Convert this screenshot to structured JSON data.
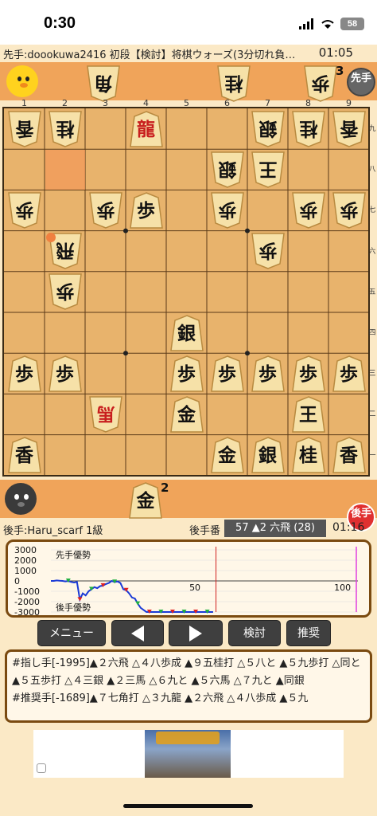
{
  "status_bar": {
    "time": "0:30",
    "battery": "58"
  },
  "header": {
    "title": "先手:doookuwa2416 初段【検討】将棋ウォーズ(3分切れ負…",
    "clock": "01:05"
  },
  "sente_badge": "先手",
  "gote_badge": "後手",
  "top_hand": [
    {
      "label": "角",
      "count": ""
    },
    {
      "label": "桂",
      "count": ""
    },
    {
      "label": "歩",
      "count": "3"
    }
  ],
  "bottom_hand": [
    {
      "label": "金",
      "count": "2"
    }
  ],
  "board": {
    "files": [
      "1",
      "2",
      "3",
      "4",
      "5",
      "6",
      "7",
      "8",
      "9"
    ],
    "ranks": [
      "九",
      "八",
      "七",
      "六",
      "五",
      "四",
      "三",
      "二",
      "一"
    ],
    "pieces": [
      {
        "col": 0,
        "row": 0,
        "label": "香",
        "side": "gote",
        "promoted": false
      },
      {
        "col": 1,
        "row": 0,
        "label": "桂",
        "side": "gote",
        "promoted": false
      },
      {
        "col": 3,
        "row": 0,
        "label": "龍",
        "side": "sente",
        "promoted": true
      },
      {
        "col": 6,
        "row": 0,
        "label": "銀",
        "side": "gote",
        "promoted": false
      },
      {
        "col": 7,
        "row": 0,
        "label": "桂",
        "side": "gote",
        "promoted": false
      },
      {
        "col": 8,
        "row": 0,
        "label": "香",
        "side": "gote",
        "promoted": false
      },
      {
        "col": 5,
        "row": 1,
        "label": "銀",
        "side": "gote",
        "promoted": false
      },
      {
        "col": 6,
        "row": 1,
        "label": "王",
        "side": "gote",
        "promoted": false
      },
      {
        "col": 0,
        "row": 2,
        "label": "歩",
        "side": "gote",
        "promoted": false
      },
      {
        "col": 2,
        "row": 2,
        "label": "歩",
        "side": "gote",
        "promoted": false
      },
      {
        "col": 3,
        "row": 2,
        "label": "歩",
        "side": "sente",
        "promoted": false
      },
      {
        "col": 5,
        "row": 2,
        "label": "歩",
        "side": "gote",
        "promoted": false
      },
      {
        "col": 7,
        "row": 2,
        "label": "歩",
        "side": "gote",
        "promoted": false
      },
      {
        "col": 8,
        "row": 2,
        "label": "歩",
        "side": "gote",
        "promoted": false
      },
      {
        "col": 1,
        "row": 3,
        "label": "飛",
        "side": "gote",
        "promoted": false
      },
      {
        "col": 6,
        "row": 3,
        "label": "歩",
        "side": "gote",
        "promoted": false
      },
      {
        "col": 1,
        "row": 4,
        "label": "歩",
        "side": "gote",
        "promoted": false
      },
      {
        "col": 4,
        "row": 5,
        "label": "銀",
        "side": "sente",
        "promoted": false
      },
      {
        "col": 0,
        "row": 6,
        "label": "歩",
        "side": "sente",
        "promoted": false
      },
      {
        "col": 1,
        "row": 6,
        "label": "歩",
        "side": "sente",
        "promoted": false
      },
      {
        "col": 4,
        "row": 6,
        "label": "歩",
        "side": "sente",
        "promoted": false
      },
      {
        "col": 5,
        "row": 6,
        "label": "歩",
        "side": "sente",
        "promoted": false
      },
      {
        "col": 6,
        "row": 6,
        "label": "歩",
        "side": "sente",
        "promoted": false
      },
      {
        "col": 7,
        "row": 6,
        "label": "歩",
        "side": "sente",
        "promoted": false
      },
      {
        "col": 8,
        "row": 6,
        "label": "歩",
        "side": "sente",
        "promoted": false
      },
      {
        "col": 2,
        "row": 7,
        "label": "馬",
        "side": "gote",
        "promoted": true
      },
      {
        "col": 4,
        "row": 7,
        "label": "金",
        "side": "sente",
        "promoted": false
      },
      {
        "col": 7,
        "row": 7,
        "label": "王",
        "side": "sente",
        "promoted": false
      },
      {
        "col": 0,
        "row": 8,
        "label": "香",
        "side": "sente",
        "promoted": false
      },
      {
        "col": 5,
        "row": 8,
        "label": "金",
        "side": "sente",
        "promoted": false
      },
      {
        "col": 6,
        "row": 8,
        "label": "銀",
        "side": "sente",
        "promoted": false
      },
      {
        "col": 7,
        "row": 8,
        "label": "桂",
        "side": "sente",
        "promoted": false
      },
      {
        "col": 8,
        "row": 8,
        "label": "香",
        "side": "sente",
        "promoted": false
      }
    ],
    "highlight": {
      "col": 1,
      "row": 1
    }
  },
  "info": {
    "gote_player": "後手:Haru_scarf 1級",
    "turn": "後手番",
    "move": "57 ▲2 六飛 (28)",
    "clock": "01:16"
  },
  "graph": {
    "y_labels": [
      "3000",
      "2000",
      "1000",
      "0",
      "-1000",
      "-2000",
      "-3000"
    ],
    "sente_label": "先手優勢",
    "gote_label": "後手優勢",
    "x_labels": [
      "50",
      "100"
    ],
    "values": [
      0,
      0,
      50,
      20,
      0,
      -50,
      0,
      -100,
      -150,
      -100,
      -1800,
      -1200,
      -1400,
      -1000,
      -800,
      -600,
      -700,
      -500,
      -450,
      -300,
      -200,
      0,
      -100,
      -50,
      -200,
      -800,
      -900,
      -1200,
      -1600,
      -1700,
      -2200,
      -2600,
      -2800,
      -3000,
      -3000,
      -3000,
      -3000,
      -3000,
      -3000,
      -3000,
      -3000,
      -3000,
      -3000,
      -3000,
      -3000,
      -3000,
      -3000,
      -3000,
      -3000,
      -3000,
      -3000,
      -3000,
      -3000,
      -3000,
      -3000,
      -3000,
      -3000
    ],
    "current_index": 57,
    "colors": {
      "line": "#1a3ad6",
      "current": "#d02020",
      "end": "#e040e0"
    }
  },
  "buttons": {
    "menu": "メニュー",
    "prev": "",
    "next": "",
    "analyze": "検討",
    "suggest": "推奨"
  },
  "notes": {
    "line1": "#指し手[-1995]▲２六飛 △４八歩成 ▲９五桂打 △５八と ▲５九歩打 △同と ▲５五歩打 △４三銀 ▲２三馬 △６九と ▲５六馬 △７九と ▲同銀",
    "line2": "#推奨手[-1689]▲７七角打 △３九龍 ▲２六飛 △４八歩成 ▲５九"
  }
}
